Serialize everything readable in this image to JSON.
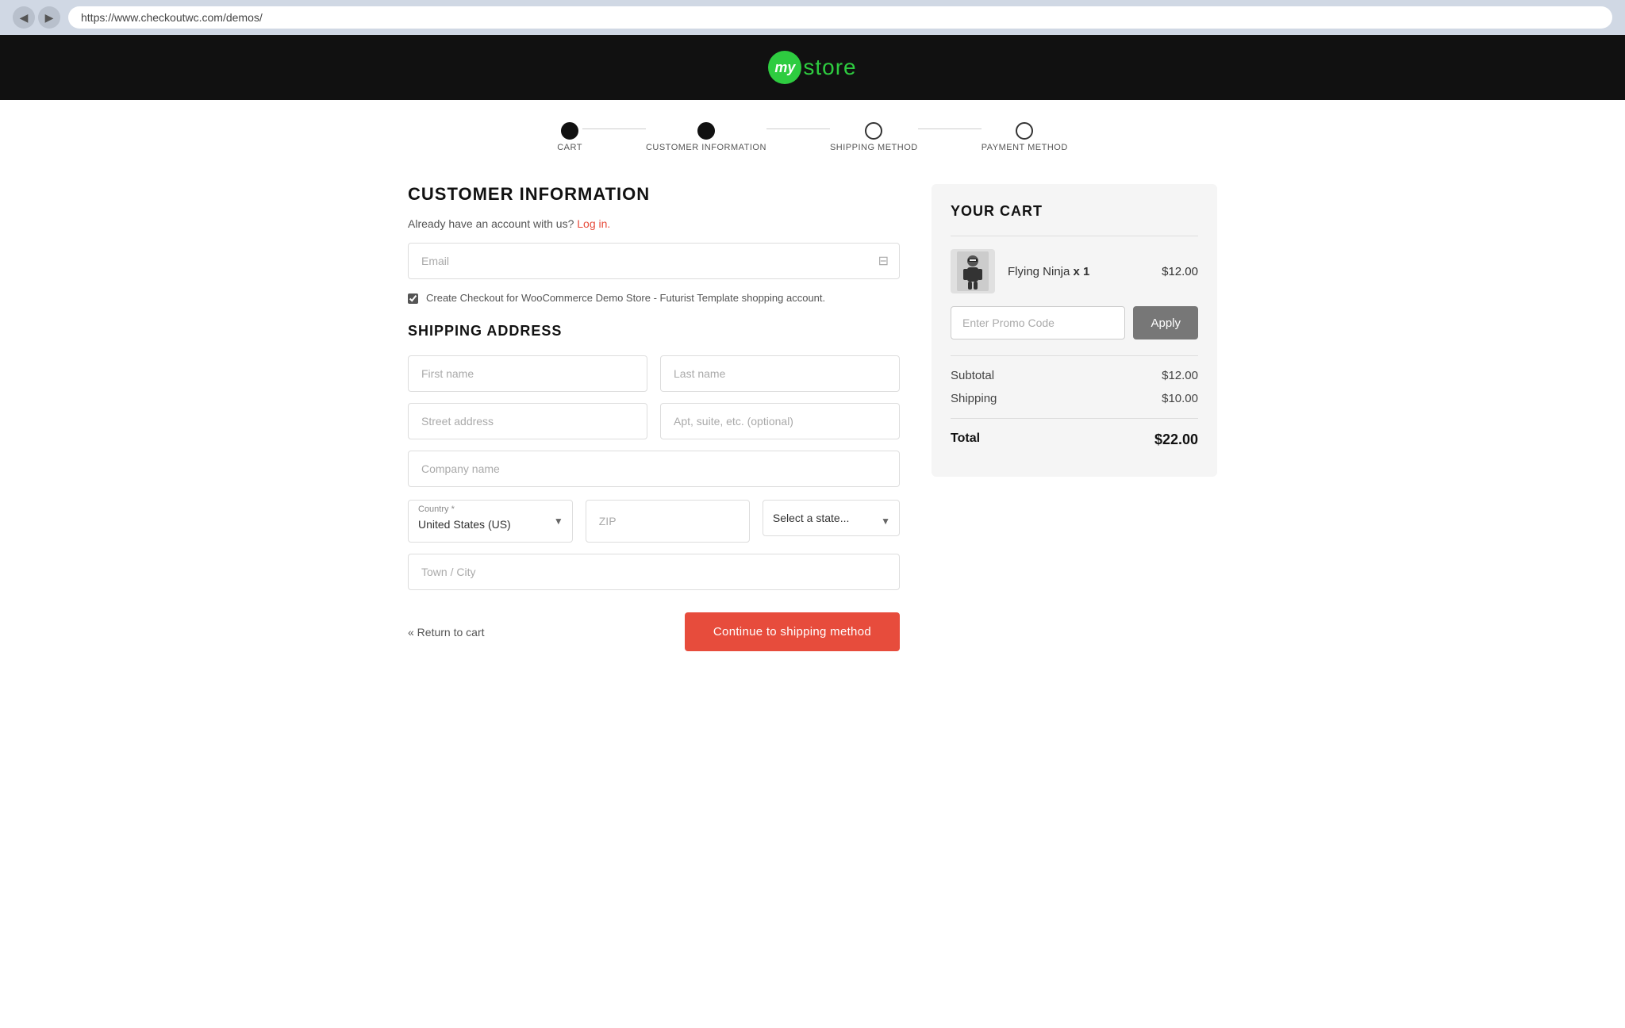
{
  "browser": {
    "url": "https://www.checkoutwc.com/demos/",
    "back_label": "◀",
    "forward_label": "▶"
  },
  "logo": {
    "circle_text": "my",
    "brand_text": "store"
  },
  "steps": [
    {
      "label": "CART",
      "state": "filled"
    },
    {
      "label": "CUSTOMER INFORMATION",
      "state": "filled"
    },
    {
      "label": "SHIPPING METHOD",
      "state": "empty"
    },
    {
      "label": "PAYMENT METHOD",
      "state": "empty"
    }
  ],
  "customer_info": {
    "title": "CUSTOMER INFORMATION",
    "login_notice": "Already have an account with us?",
    "login_link_label": "Log in.",
    "email_placeholder": "Email",
    "checkbox_label": "Create Checkout for WooCommerce Demo Store - Futurist Template shopping account."
  },
  "shipping_address": {
    "title": "SHIPPING ADDRESS",
    "first_name_placeholder": "First name",
    "last_name_placeholder": "Last name",
    "street_placeholder": "Street address",
    "apt_placeholder": "Apt, suite, etc. (optional)",
    "company_placeholder": "Company name",
    "country_label": "Country *",
    "country_value": "United States (US)",
    "zip_placeholder": "ZIP",
    "state_placeholder": "Select a state...",
    "city_placeholder": "Town / City"
  },
  "actions": {
    "return_label": "« Return to cart",
    "continue_label": "Continue to shipping method"
  },
  "cart": {
    "title": "YOUR CART",
    "item_name": "Flying Ninja",
    "item_qty": "x 1",
    "item_price": "$12.00",
    "promo_placeholder": "Enter Promo Code",
    "apply_label": "Apply",
    "subtotal_label": "Subtotal",
    "subtotal_value": "$12.00",
    "shipping_label": "Shipping",
    "shipping_value": "$10.00",
    "total_label": "Total",
    "total_value": "$22.00"
  }
}
